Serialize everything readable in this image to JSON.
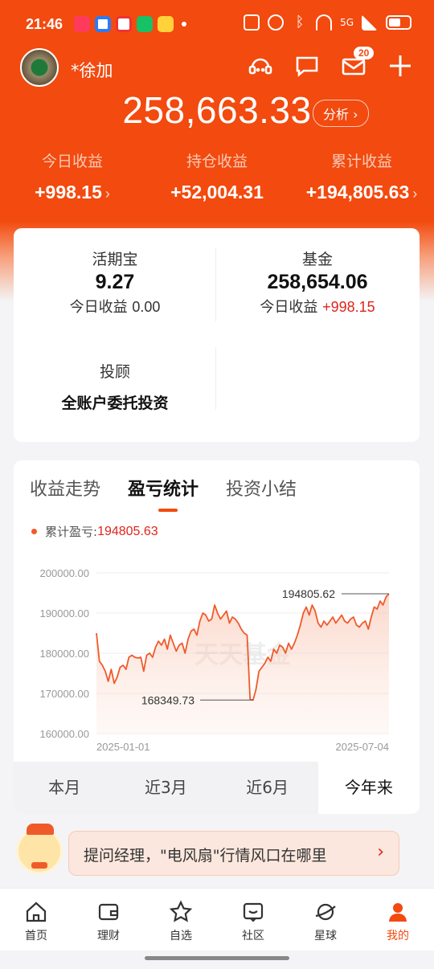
{
  "status_bar": {
    "time": "21:46",
    "network": "5G"
  },
  "header": {
    "username": "*徐加",
    "message_badge": "20",
    "total_assets": "258,663.33",
    "analyze_label": "分析 ›",
    "earnings": [
      {
        "label": "今日收益",
        "value": "+998.15",
        "chevron": "›"
      },
      {
        "label": "持仓收益",
        "value": "+52,004.31",
        "chevron": ""
      },
      {
        "label": "累计收益",
        "value": "+194,805.63",
        "chevron": "›"
      }
    ]
  },
  "accounts": {
    "huoqibao": {
      "title": "活期宝",
      "amount": "9.27",
      "today_label": "今日收益",
      "today_value": "0.00"
    },
    "fund": {
      "title": "基金",
      "amount": "258,654.06",
      "today_label": "今日收益",
      "today_value": "+998.15"
    },
    "advisor": {
      "title": "投顾",
      "desc": "全账户委托投资"
    }
  },
  "chart_section": {
    "tabs": [
      "收益走势",
      "盈亏统计",
      "投资小结"
    ],
    "active_tab": 1,
    "legend_label": "累计盈亏:",
    "legend_value": "194805.63",
    "watermark": "天天基金",
    "periods": [
      "本月",
      "近3月",
      "近6月",
      "今年来"
    ],
    "selected_period": 3
  },
  "chart_data": {
    "type": "area",
    "title": "",
    "xlabel": "",
    "ylabel": "",
    "ylim": [
      160000,
      200000
    ],
    "yticks": [
      "200000.00",
      "190000.00",
      "180000.00",
      "170000.00",
      "160000.00"
    ],
    "xticks": [
      "2025-01-01",
      "2025-07-04"
    ],
    "annotations": [
      {
        "label": "194805.62",
        "x": 1.0,
        "y": 194805.62
      },
      {
        "label": "168349.73",
        "x": 0.52,
        "y": 168349.73
      }
    ],
    "series": [
      {
        "values": [
          185000,
          178000,
          177000,
          175500,
          173000,
          176000,
          172500,
          174000,
          176500,
          177000,
          176000,
          179000,
          179500,
          179000,
          178800,
          179000,
          175500,
          179500,
          180000,
          179000,
          181500,
          183000,
          182000,
          183500,
          181000,
          184500,
          182500,
          180500,
          182000,
          182500,
          180000,
          183500,
          185500,
          186000,
          184500,
          188000,
          190000,
          189500,
          188000,
          188500,
          192000,
          190000,
          188500,
          189500,
          190500,
          187500,
          189000,
          188500,
          187500,
          186000,
          185000,
          184500,
          168500,
          168349.73,
          171000,
          175500,
          176500,
          177500,
          179000,
          178000,
          181000,
          180000,
          182000,
          181500,
          180000,
          182500,
          181000,
          182500,
          184500,
          187000,
          190000,
          191500,
          189500,
          192000,
          190500,
          187500,
          186500,
          188000,
          187000,
          188000,
          189000,
          187500,
          188500,
          189500,
          188000,
          187500,
          188500,
          189000,
          187000,
          186500,
          187500,
          188000,
          186000,
          189000,
          191500,
          191000,
          193000,
          192000,
          194000,
          194805.62
        ]
      }
    ]
  },
  "banner": {
    "text": "提问经理，\"电风扇\"行情风口在哪里",
    "arrow": "›"
  },
  "tabbar": [
    {
      "label": "首页",
      "icon": "home-icon"
    },
    {
      "label": "理财",
      "icon": "wallet-icon"
    },
    {
      "label": "自选",
      "icon": "star-icon"
    },
    {
      "label": "社区",
      "icon": "community-icon"
    },
    {
      "label": "星球",
      "icon": "planet-icon"
    },
    {
      "label": "我的",
      "icon": "user-icon"
    }
  ],
  "colors": {
    "brand": "#f24a0f",
    "gain": "#e0241b",
    "line": "#f05a2a"
  }
}
